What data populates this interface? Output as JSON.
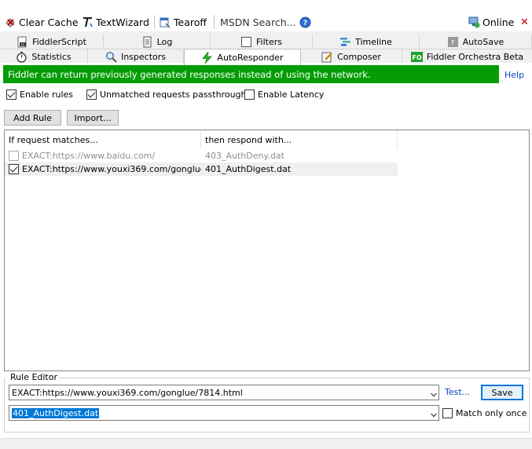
{
  "toolbar": {
    "clear_cache": "Clear Cache",
    "textwizard": "TextWizard",
    "tearoff": "Tearoff",
    "msdn_search": "MSDN Search...",
    "online": "Online"
  },
  "tabs_row1": [
    "FiddlerScript",
    "Log",
    "Filters",
    "Timeline",
    "AutoSave"
  ],
  "tabs_row2": [
    "Statistics",
    "Inspectors",
    "AutoResponder",
    "Composer",
    "Fiddler Orchestra Beta"
  ],
  "active_tab": "AutoResponder",
  "banner": {
    "text": "Fiddler can return previously generated responses instead of using the network.",
    "help": "Help",
    "color": "#059d05"
  },
  "options": {
    "enable_rules": {
      "label": "Enable rules",
      "checked": true
    },
    "unmatched_passthrough": {
      "label": "Unmatched requests passthrough",
      "checked": true
    },
    "enable_latency": {
      "label": "Enable Latency",
      "checked": false
    }
  },
  "buttons": {
    "add_rule": "Add Rule",
    "import": "Import..."
  },
  "rules_table": {
    "columns": [
      "If request matches...",
      "then respond with..."
    ],
    "rows": [
      {
        "match": "EXACT:https://www.baidu.com/",
        "respond": "403_AuthDeny.dat",
        "enabled": false
      },
      {
        "match": "EXACT:https://www.youxi369.com/gonglue/...",
        "respond": "401_AuthDigest.dat",
        "enabled": true
      }
    ]
  },
  "rule_editor": {
    "title": "Rule Editor",
    "match_value": "EXACT:https://www.youxi369.com/gonglue/7814.html",
    "respond_value": "401_AuthDigest.dat",
    "test_label": "Test...",
    "save_label": "Save",
    "match_only_once": {
      "label": "Match only once",
      "checked": false
    }
  }
}
